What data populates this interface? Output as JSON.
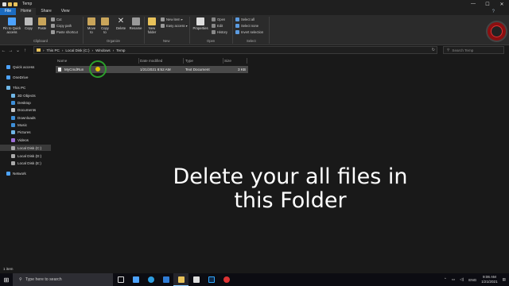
{
  "window": {
    "title": "Temp",
    "controls": [
      "—",
      "☐",
      "✕"
    ]
  },
  "tabs": [
    "File",
    "Home",
    "Share",
    "View"
  ],
  "ribbon": {
    "pin_label": [
      "Pin to Quick",
      "access"
    ],
    "copy_label": "Copy",
    "paste_label": "Paste",
    "cut_label": "Cut",
    "copy_path_label": "Copy path",
    "paste_shortcut_label": "Paste shortcut",
    "move_to_label": [
      "Move",
      "to"
    ],
    "copy_to_label": [
      "Copy",
      "to"
    ],
    "delete_label": "Delete",
    "rename_label": "Rename",
    "new_folder_label": [
      "New",
      "folder"
    ],
    "new_item_label": "New item ▾",
    "easy_access_label": "Easy access ▾",
    "properties_label": "Properties",
    "open_label": "Open",
    "edit_label": "Edit",
    "history_label": "History",
    "select_all_label": "Select all",
    "select_none_label": "Select none",
    "invert_selection_label": "Invert selection",
    "groups": [
      "Clipboard",
      "Organize",
      "New",
      "Open",
      "Select"
    ]
  },
  "address": {
    "path": [
      "This PC",
      "Local Disk (C:)",
      "Windows",
      "Temp"
    ],
    "search_placeholder": "Search Temp"
  },
  "sidebar": {
    "items": [
      {
        "label": "Quick access",
        "icon": "star-icon",
        "color": "#4da3ff"
      },
      {
        "label": "OneDrive",
        "icon": "cloud-icon",
        "color": "#4da3ff"
      },
      {
        "label": "This PC",
        "icon": "computer-icon",
        "color": "#6fb6e6"
      },
      {
        "label": "3D Objects",
        "icon": "cube-icon",
        "color": "#6fb6e6"
      },
      {
        "label": "Desktop",
        "icon": "desktop-icon",
        "color": "#3e8fd8"
      },
      {
        "label": "Documents",
        "icon": "document-icon",
        "color": "#c6c6c6"
      },
      {
        "label": "Downloads",
        "icon": "download-icon",
        "color": "#3e8fd8"
      },
      {
        "label": "Music",
        "icon": "music-icon",
        "color": "#3e8fd8"
      },
      {
        "label": "Pictures",
        "icon": "picture-icon",
        "color": "#6fb6e6"
      },
      {
        "label": "Videos",
        "icon": "video-icon",
        "color": "#9d6fd8"
      },
      {
        "label": "Local Disk (C:)",
        "icon": "drive-icon",
        "color": "#aaaaaa"
      },
      {
        "label": "Local Disk (D:)",
        "icon": "drive-icon",
        "color": "#aaaaaa"
      },
      {
        "label": "Local Disk (E:)",
        "icon": "drive-icon",
        "color": "#aaaaaa"
      },
      {
        "label": "Network",
        "icon": "network-icon",
        "color": "#4da3ff"
      }
    ]
  },
  "columns": [
    "Name",
    "Date modified",
    "Type",
    "Size"
  ],
  "files": [
    {
      "name": "MyCmdRun",
      "date": "1/21/2021 8:52 AM",
      "type": "Text Document",
      "size": "3 KB"
    }
  ],
  "caption": [
    "Delete your all files in",
    "this Folder"
  ],
  "status": {
    "count": "1 item"
  },
  "taskbar": {
    "search_placeholder": "Type here to search",
    "lang": "ENG",
    "time": "9:06 AM",
    "date": "1/21/2021"
  },
  "colors": {
    "accent": "#1b6bc0",
    "selection": "#4a4a4a",
    "ring": "#2c9f2c"
  }
}
